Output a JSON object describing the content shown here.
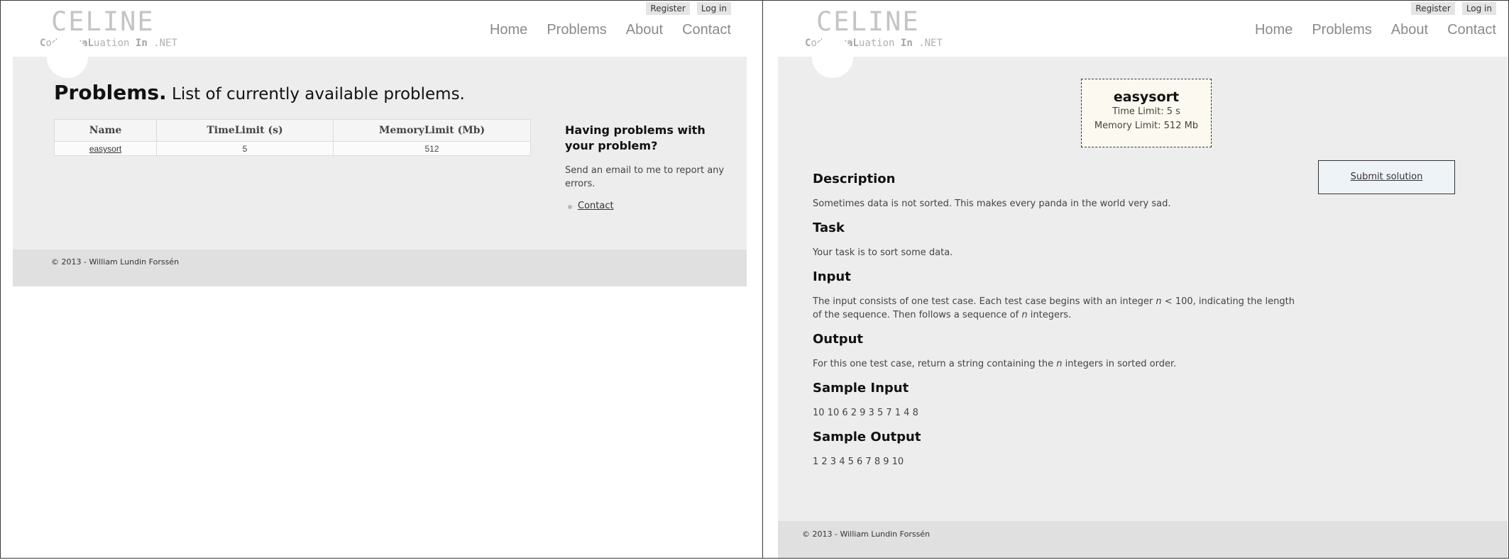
{
  "site": {
    "logo": "CELINE",
    "tagline_parts": [
      "C",
      "ode ",
      "Eva",
      "L",
      "uation ",
      "In",
      " .NET"
    ],
    "register_label": "Register",
    "login_label": "Log in",
    "nav": [
      "Home",
      "Problems",
      "About",
      "Contact"
    ],
    "footer": "© 2013 - William Lundin Forssén"
  },
  "problems_page": {
    "heading_strong": "Problems.",
    "heading_rest": "List of currently available problems.",
    "columns": [
      "Name",
      "TimeLimit (s)",
      "MemoryLimit (Mb)"
    ],
    "rows": [
      {
        "name": "easysort",
        "time_limit": "5",
        "memory_limit": "512"
      }
    ],
    "aside": {
      "title": "Having problems with your problem?",
      "text": "Send an email to me to report any errors.",
      "link": "Contact"
    }
  },
  "problem_page": {
    "name": "easysort",
    "time_limit": "Time Limit: 5 s",
    "memory_limit": "Memory Limit: 512 Mb",
    "submit_label": "Submit solution",
    "sections": {
      "description_title": "Description",
      "description_text": "Sometimes data is not sorted. This makes every panda in the world very sad.",
      "task_title": "Task",
      "task_text": "Your task is to sort some data.",
      "input_title": "Input",
      "input_text_1": "The input consists of one test case. Each test case begins with an integer ",
      "input_var_n": "n",
      "input_text_2": " < 100, indicating the length of the sequence. Then follows a sequence of ",
      "input_var_n2": "n",
      "input_text_3": " integers.",
      "output_title": "Output",
      "output_text_1": "For this one test case, return a string containing the ",
      "output_var_n": "n",
      "output_text_2": " integers in sorted order.",
      "sample_input_title": "Sample Input",
      "sample_input": "10 10 6 2 9 3 5 7 1 4 8",
      "sample_output_title": "Sample Output",
      "sample_output": "1 2 3 4 5 6 7 8 9 10"
    }
  }
}
